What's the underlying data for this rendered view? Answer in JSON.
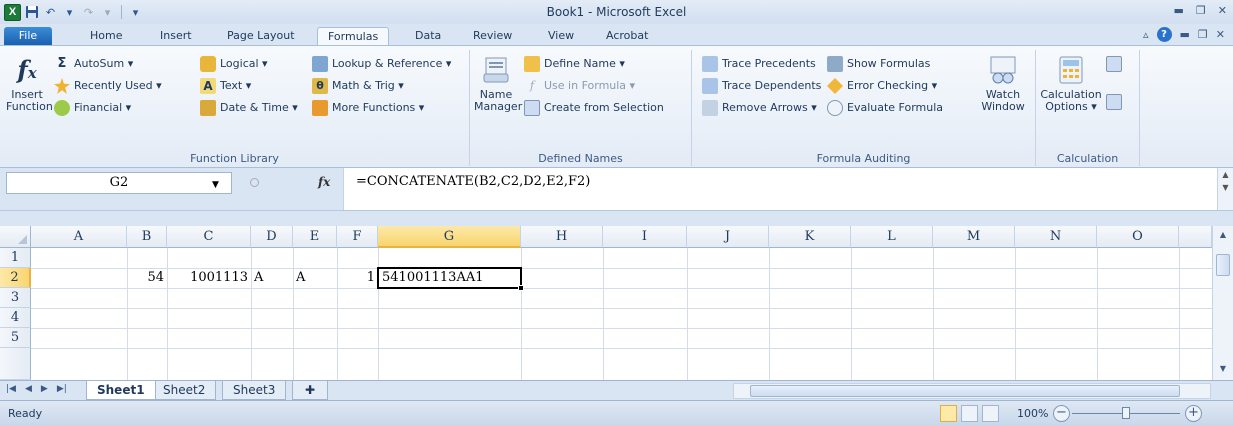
{
  "window": {
    "title": "Book1 - Microsoft Excel",
    "qat_undo": "↶",
    "qat_redo": "↷",
    "qat_customize": "▾"
  },
  "tabs": {
    "file": "File",
    "items": [
      "Home",
      "Insert",
      "Page Layout",
      "Formulas",
      "Data",
      "Review",
      "View",
      "Acrobat"
    ],
    "active": "Formulas"
  },
  "ribbon": {
    "function_library": {
      "label": "Function Library",
      "insert_function": "Insert Function",
      "insert_function_line1": "Insert",
      "insert_function_line2": "Function",
      "autosum": "AutoSum ▾",
      "recently_used": "Recently Used ▾",
      "financial": "Financial ▾",
      "logical": "Logical ▾",
      "text": "Text ▾",
      "date_time": "Date & Time ▾",
      "lookup_reference": "Lookup & Reference ▾",
      "math_trig": "Math & Trig ▾",
      "more_functions": "More Functions ▾"
    },
    "defined_names": {
      "label": "Defined Names",
      "name_manager_line1": "Name",
      "name_manager_line2": "Manager",
      "define_name": "Define Name ▾",
      "use_in_formula": "Use in Formula ▾",
      "create_from_selection": "Create from Selection"
    },
    "formula_auditing": {
      "label": "Formula Auditing",
      "trace_precedents": "Trace Precedents",
      "trace_dependents": "Trace Dependents",
      "remove_arrows": "Remove Arrows ▾",
      "show_formulas": "Show Formulas",
      "error_checking": "Error Checking ▾",
      "evaluate_formula": "Evaluate Formula",
      "watch_window_line1": "Watch",
      "watch_window_line2": "Window"
    },
    "calculation": {
      "label": "Calculation",
      "options_line1": "Calculation",
      "options_line2": "Options ▾"
    }
  },
  "formula_bar": {
    "name_box": "G2",
    "fx": "fx",
    "formula": "=CONCATENATE(B2,C2,D2,E2,F2)"
  },
  "grid": {
    "columns": [
      "A",
      "B",
      "C",
      "D",
      "E",
      "F",
      "G",
      "H",
      "I",
      "J",
      "K",
      "L",
      "M",
      "N",
      "O"
    ],
    "rows": [
      "1",
      "2",
      "3",
      "4",
      "5"
    ],
    "selected_column": "G",
    "selected_row": "2",
    "cells": {
      "B2": "54",
      "C2": "1001113",
      "D2": "A",
      "E2": "A",
      "F2": "1",
      "G2": "541001113AA1"
    }
  },
  "sheets": {
    "items": [
      "Sheet1",
      "Sheet2",
      "Sheet3"
    ],
    "active": "Sheet1"
  },
  "status": {
    "text": "Ready",
    "zoom": "100%"
  },
  "colors": {
    "accent": "#2a73cc",
    "excel_green": "#1d7a3a",
    "selection_header": "#f9d56f"
  }
}
